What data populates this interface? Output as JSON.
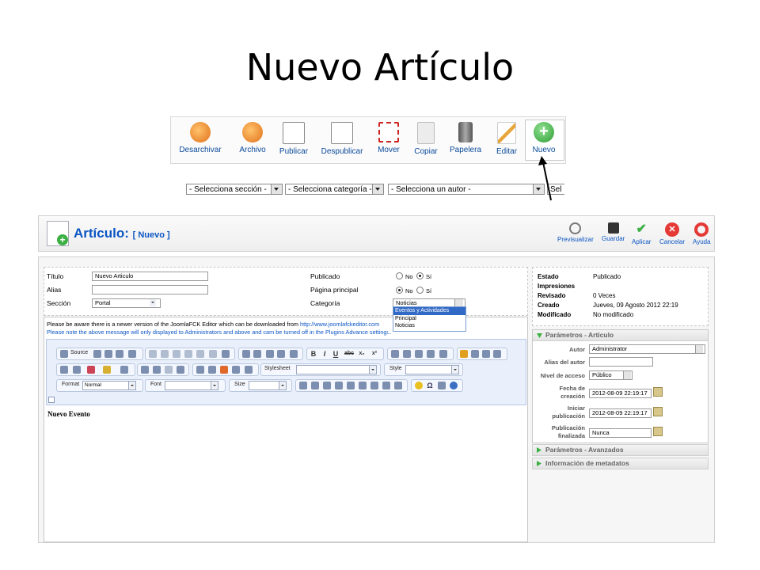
{
  "slide": {
    "title": "Nuevo Artículo"
  },
  "toolbar": {
    "buttons": [
      {
        "label": "Desarchivar",
        "icon": "unarchive-icon",
        "color": "#f08a24"
      },
      {
        "label": "Archivo",
        "icon": "archive-icon",
        "color": "#f08a24"
      },
      {
        "label": "Publicar",
        "icon": "publish-icon",
        "color": "#5cb85c"
      },
      {
        "label": "Despublicar",
        "icon": "unpublish-icon",
        "color": "#d9534f"
      },
      {
        "label": "Mover",
        "icon": "move-icon",
        "color": "#cc2222"
      },
      {
        "label": "Copiar",
        "icon": "copy-icon",
        "color": "#cccccc"
      },
      {
        "label": "Papelera",
        "icon": "trash-icon",
        "color": "#666666"
      },
      {
        "label": "Editar",
        "icon": "edit-icon",
        "color": "#e8a63a"
      },
      {
        "label": "Nuevo",
        "icon": "new-icon",
        "color": "#3cb043"
      }
    ]
  },
  "filters": {
    "section": "- Selecciona sección -",
    "category": "- Selecciona categoría -",
    "author": "- Selecciona un autor -",
    "extra": "Sel"
  },
  "article": {
    "title": "Artículo:",
    "subtitle": "[ Nuevo ]",
    "actions": [
      "Previsualizar",
      "Guardar",
      "Aplicar",
      "Cancelar",
      "Ayuda"
    ]
  },
  "form": {
    "title_label": "Título",
    "title_value": "Nuevo Articulo",
    "alias_label": "Alias",
    "alias_value": "",
    "section_label": "Sección",
    "section_value": "Portal",
    "published_label": "Publicado",
    "frontpage_label": "Página principal",
    "category_label": "Categoría",
    "category_value": "Noticias",
    "no": "No",
    "yes": "Sí",
    "category_options": [
      "Eventos y Actividades",
      "Principal",
      "Noticias"
    ]
  },
  "editor": {
    "notice1_a": "Please be aware there is a newer version of the JoomlaFCK Editor which can be downloaded from ",
    "notice1_link": "http://www.joomlafckeditor.com",
    "notice2": "Please note the above message will only displayed to Administrators and above and cam be turned off in the Plugins Advance settings.",
    "source": "Source",
    "stylesheet": "Stylesheet",
    "style": "Style",
    "format": "Format",
    "format_value": "Normal",
    "font": "Font",
    "size": "Size",
    "content": "Nuevo Evento"
  },
  "info": {
    "rows": [
      {
        "label": "Estado",
        "value": "Publicado"
      },
      {
        "label": "Impresiones",
        "value": ""
      },
      {
        "label": "Revisado",
        "value": "0 Veces"
      },
      {
        "label": "Creado",
        "value": "Jueves, 09 Agosto 2012 22:19"
      },
      {
        "label": "Modificado",
        "value": "No modificado"
      }
    ]
  },
  "params": {
    "header": "Parámetros - Artículo",
    "author_label": "Autor",
    "author_value": "Administrator",
    "alias_label": "Alias del autor",
    "access_label": "Nivel de acceso",
    "access_value": "Público",
    "created_label_1": "Fecha de",
    "created_label_2": "creación",
    "created_value": "2012-08-09 22:19:17",
    "start_label_1": "Iniciar",
    "start_label_2": "publicación",
    "start_value": "2012-08-09 22:19:17",
    "end_label_1": "Publicación",
    "end_label_2": "finalizada",
    "end_value": "Nunca",
    "advanced": "Parámetros - Avanzados",
    "metadata": "Información de metadatos"
  }
}
